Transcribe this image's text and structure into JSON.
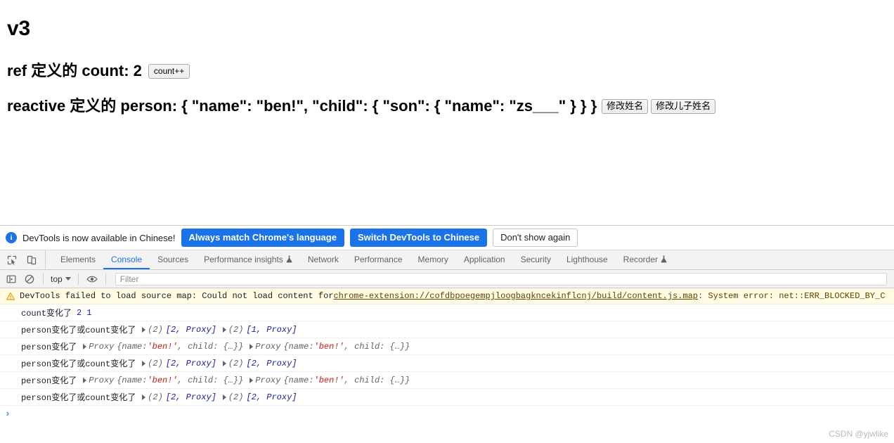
{
  "page": {
    "title": "v3",
    "ref_line": "ref 定义的 count: 2",
    "count_button": "count++",
    "person_line": "reactive 定义的 person: { \"name\": \"ben!\", \"child\": { \"son\": { \"name\": \"zs___\" } } }",
    "person_buttons": [
      "修改姓名",
      "修改儿子姓名"
    ]
  },
  "devtools": {
    "infobar": {
      "message": "DevTools is now available in Chinese!",
      "primary_button": "Always match Chrome's language",
      "secondary_button": "Switch DevTools to Chinese",
      "dismiss_button": "Don't show again",
      "icon": "info-icon"
    },
    "toolbar_icons": [
      {
        "name": "inspect-element-icon"
      },
      {
        "name": "device-toolbar-icon"
      }
    ],
    "tabs": [
      {
        "label": "Elements",
        "active": false,
        "flask": false
      },
      {
        "label": "Console",
        "active": true,
        "flask": false
      },
      {
        "label": "Sources",
        "active": false,
        "flask": false
      },
      {
        "label": "Performance insights",
        "active": false,
        "flask": true
      },
      {
        "label": "Network",
        "active": false,
        "flask": false
      },
      {
        "label": "Performance",
        "active": false,
        "flask": false
      },
      {
        "label": "Memory",
        "active": false,
        "flask": false
      },
      {
        "label": "Application",
        "active": false,
        "flask": false
      },
      {
        "label": "Security",
        "active": false,
        "flask": false
      },
      {
        "label": "Lighthouse",
        "active": false,
        "flask": false
      },
      {
        "label": "Recorder",
        "active": false,
        "flask": true
      }
    ],
    "console_toolbar": {
      "execute_icon": "console-sidebar-icon",
      "clear_icon": "clear-console-icon",
      "context_selector": "top",
      "eye_icon": "live-expression-icon",
      "filter_placeholder": "Filter",
      "filter_value": ""
    },
    "console_messages": [
      {
        "type": "warning",
        "icon": "warning-triangle-icon",
        "text_before": "DevTools failed to load source map: Could not load content for ",
        "link": "chrome-extension://cofdbpoegempjloogbagkncekinflcnj/build/content.js.map",
        "text_after": ": System error: net::ERR_BLOCKED_BY_C"
      },
      {
        "type": "log",
        "label": "count变化了",
        "tokens": [
          "2",
          "1"
        ]
      },
      {
        "type": "log",
        "label": "person变化了或count变化了",
        "groups": [
          {
            "count": "(2)",
            "preview": "[2, Proxy]"
          },
          {
            "count": "(2)",
            "preview": "[1, Proxy]"
          }
        ]
      },
      {
        "type": "log",
        "label": "person变化了",
        "proxies": [
          {
            "name": "Proxy",
            "body_open": "{name: ",
            "str": "'ben!'",
            "body_close": ", child: {…}}"
          },
          {
            "name": "Proxy",
            "body_open": "{name: ",
            "str": "'ben!'",
            "body_close": ", child: {…}}"
          }
        ]
      },
      {
        "type": "log",
        "label": "person变化了或count变化了",
        "groups": [
          {
            "count": "(2)",
            "preview": "[2, Proxy]"
          },
          {
            "count": "(2)",
            "preview": "[2, Proxy]"
          }
        ]
      },
      {
        "type": "log",
        "label": "person变化了",
        "proxies": [
          {
            "name": "Proxy",
            "body_open": "{name: ",
            "str": "'ben!'",
            "body_close": ", child: {…}}"
          },
          {
            "name": "Proxy",
            "body_open": "{name: ",
            "str": "'ben!'",
            "body_close": ", child: {…}}"
          }
        ]
      },
      {
        "type": "log",
        "label": "person变化了或count变化了",
        "groups": [
          {
            "count": "(2)",
            "preview": "[2, Proxy]"
          },
          {
            "count": "(2)",
            "preview": "[2, Proxy]"
          }
        ]
      }
    ],
    "prompt": {
      "caret": "›",
      "value": ""
    }
  },
  "watermark": "CSDN @yjwlike",
  "colors": {
    "accent_blue": "#1a73e8",
    "warning_bg": "#fffbe5",
    "warning_text": "#5c4400",
    "string_red": "#c41a16",
    "number_blue": "#1a1aa6"
  }
}
